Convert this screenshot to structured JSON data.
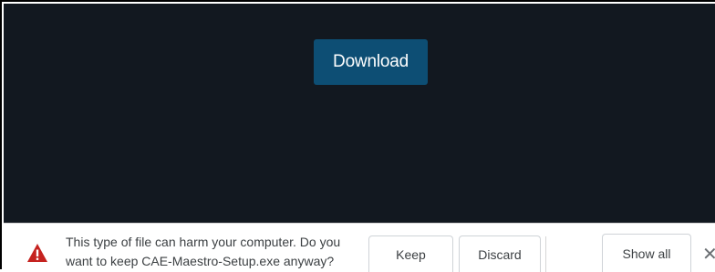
{
  "page": {
    "download_label": "Download"
  },
  "download_shelf": {
    "warning_icon": "warning-triangle-icon",
    "warning_line1": "This type of file can harm your computer. Do you",
    "warning_line2": "want to keep CAE-Maestro-Setup.exe anyway?",
    "keep_label": "Keep",
    "discard_label": "Discard",
    "show_all_label": "Show all",
    "close_glyph": "✕",
    "close_icon": "close-icon"
  },
  "colors": {
    "page_background": "#121820",
    "download_button": "#0d4e74",
    "warning_red": "#c5221f",
    "shelf_text": "#3c4043"
  }
}
